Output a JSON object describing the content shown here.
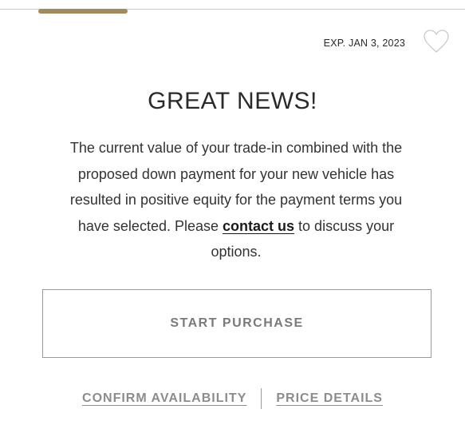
{
  "card": {
    "expiry": "EXP. JAN 3, 2023",
    "headline": "GREAT NEWS!",
    "message_before_link": "The current value of your trade-in combined with the proposed down payment for your new vehicle has resulted in positive equity for the payment terms you have selected. Please ",
    "message_link": "contact us",
    "message_after_link": " to discuss your options.",
    "start_button": "START PURCHASE",
    "confirm_link": "CONFIRM AVAILABILITY",
    "price_link": "PRICE DETAILS"
  },
  "icons": {
    "favorite": "heart-outline-icon"
  },
  "colors": {
    "accent": "#a08a5e",
    "button_border": "#9a9a9a",
    "muted_text": "#8c8c8c"
  }
}
